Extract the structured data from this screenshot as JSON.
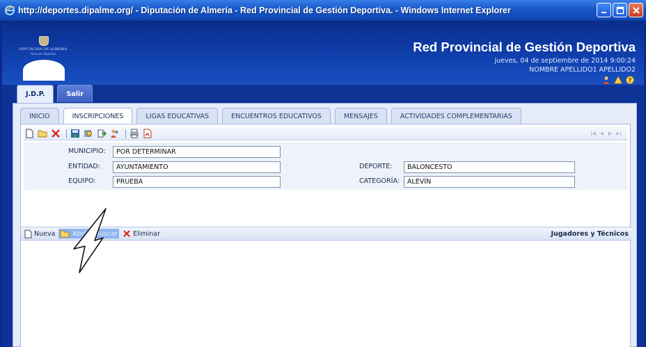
{
  "window": {
    "title": "http://deportes.dipalme.org/ - Diputación de Almería - Red Provincial de Gestión Deportiva. - Windows Internet Explorer"
  },
  "header": {
    "logo_org": "DIPUTACIÓN DE ALMERÍA",
    "logo_area": "Área de Deporte",
    "brand": "Red Provincial de Gestión Deportiva",
    "datetime": "jueves, 04 de septiembre de 2014 9:00:24",
    "username": "NOMBRE APELLIDO1 APELLIDO2",
    "icons": [
      "user-icon",
      "warning-icon",
      "help-icon"
    ]
  },
  "top_tabs": [
    {
      "label": "J.D.P.",
      "active": true
    },
    {
      "label": "Salir",
      "active": false
    }
  ],
  "sub_tabs": [
    {
      "label": "INICIO",
      "active": false
    },
    {
      "label": "INSCRIPCIONES",
      "active": true
    },
    {
      "label": "LIGAS EDUCATIVAS",
      "active": false
    },
    {
      "label": "ENCUENTROS EDUCATIVOS",
      "active": false
    },
    {
      "label": "MENSAJES",
      "active": false
    },
    {
      "label": "ACTIVIDADES COMPLEMENTARIAS",
      "active": false
    }
  ],
  "toolbar": {
    "icons": [
      "new-document-icon",
      "open-folder-icon",
      "delete-icon",
      "save-icon",
      "search-icon",
      "export-icon",
      "users-icon",
      "print-icon",
      "pdf-icon"
    ],
    "pager_icons": [
      "first-page-icon",
      "previous-page-icon",
      "next-page-icon",
      "last-page-icon"
    ]
  },
  "form": {
    "municipio": {
      "label": "MUNICIPIO:",
      "value": "POR DETERMINAR"
    },
    "entidad": {
      "label": "ENTIDAD:",
      "value": "AYUNTAMIENTO"
    },
    "equipo": {
      "label": "EQUIPO:",
      "value": "PRUEBA"
    },
    "deporte": {
      "label": "DEPORTE:",
      "value": "BALONCESTO"
    },
    "categoria": {
      "label": "CATEGORÍA:",
      "value": "ALEVÍN"
    }
  },
  "actions": {
    "nueva": "Nueva",
    "abrir": "Abrir / Buscar",
    "eliminar": "Eliminar",
    "section_title": "Jugadores y Técnicos"
  },
  "colors": {
    "title_bar": "#1657c9",
    "header_bg": "#1041b0",
    "panel_bg": "#e6edf9",
    "highlight": "#8fb3ef"
  }
}
